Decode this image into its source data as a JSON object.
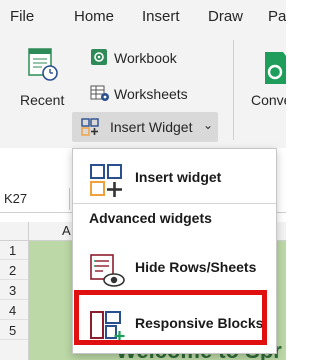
{
  "menu_tabs": [
    "File",
    "Home",
    "Insert",
    "Draw",
    "Pa"
  ],
  "ribbon": {
    "recent_label": "Recent",
    "workbook_label": "Workbook",
    "worksheets_label": "Worksheets",
    "insert_widget_label": "Insert Widget",
    "conve_label": "Conve"
  },
  "sheet": {
    "name_box": "K27",
    "column_a": "A",
    "row_numbers": [
      "1",
      "2",
      "3",
      "4",
      "5"
    ],
    "welcome_text": "Welcome to Spr"
  },
  "dropdown": {
    "insert_widget_item": "Insert widget",
    "section_heading": "Advanced widgets",
    "hide_rows_item": "Hide Rows/Sheets",
    "responsive_blocks_item": "Responsive Blocks"
  },
  "colors": {
    "accent_green": "#2e8b57",
    "highlight_red": "#e01010",
    "orange": "#f0a03c",
    "sheet_green": "#bcd8a6"
  },
  "icons": {
    "recent": "recent-icon",
    "workbook": "workbook-icon",
    "worksheets": "worksheets-icon",
    "insert_widget": "insert-widget-icon",
    "conve": "convert-icon",
    "hide_rows": "hide-rows-icon",
    "responsive_blocks": "responsive-blocks-icon"
  }
}
